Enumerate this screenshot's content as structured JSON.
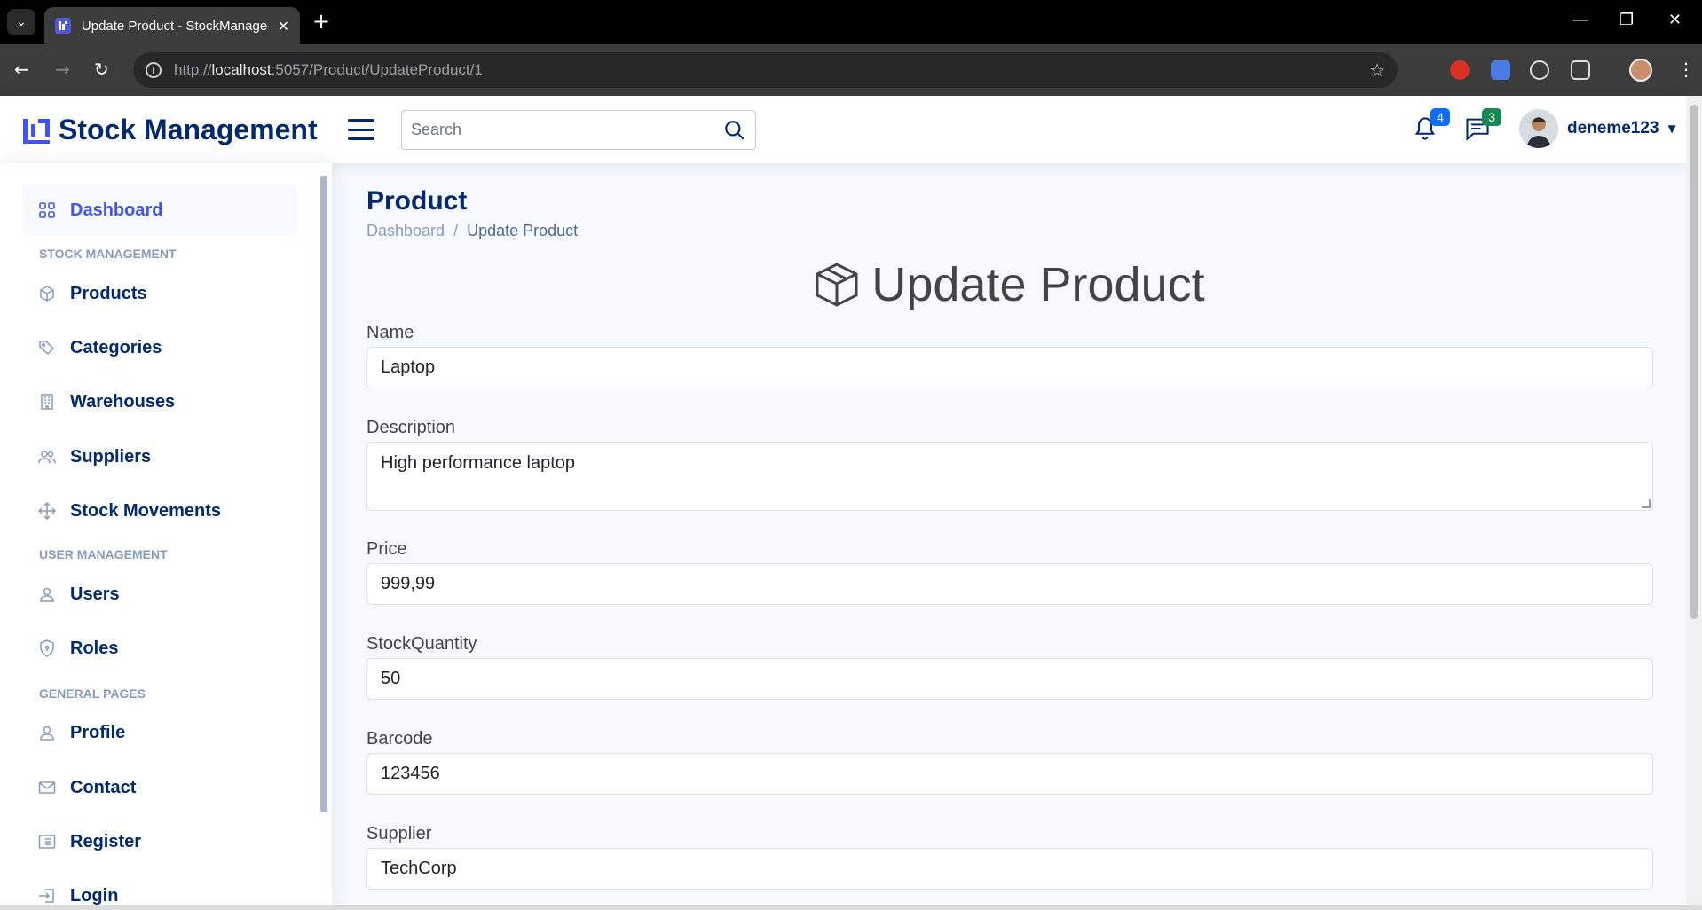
{
  "browser": {
    "tab_title": "Update Product - StockManage",
    "url_host": "localhost",
    "url_rest": ":5057/Product/UpdateProduct/1",
    "url_prefix": "http://"
  },
  "header": {
    "brand": "Stock Management",
    "search_placeholder": "Search",
    "notifications_count": "4",
    "messages_count": "3",
    "username": "deneme123"
  },
  "sidebar": {
    "dashboard": "Dashboard",
    "heading_stock": "STOCK MANAGEMENT",
    "products": "Products",
    "categories": "Categories",
    "warehouses": "Warehouses",
    "suppliers": "Suppliers",
    "stock_movements": "Stock Movements",
    "heading_user": "USER MANAGEMENT",
    "users": "Users",
    "roles": "Roles",
    "heading_general": "GENERAL PAGES",
    "profile": "Profile",
    "contact": "Contact",
    "register": "Register",
    "login": "Login"
  },
  "main": {
    "page_title": "Product",
    "breadcrumb_home": "Dashboard",
    "breadcrumb_sep": "/",
    "breadcrumb_current": "Update Product",
    "form_title": "Update Product",
    "fields": {
      "name_label": "Name",
      "name_value": "Laptop",
      "description_label": "Description",
      "description_value": "High performance laptop",
      "price_label": "Price",
      "price_value": "999,99",
      "stock_label": "StockQuantity",
      "stock_value": "50",
      "barcode_label": "Barcode",
      "barcode_value": "123456",
      "supplier_label": "Supplier",
      "supplier_value": "TechCorp"
    }
  },
  "colors": {
    "brand": "#012970",
    "accent": "#4154f1",
    "notif_badge": "#0d6efd",
    "msg_badge": "#198754"
  }
}
